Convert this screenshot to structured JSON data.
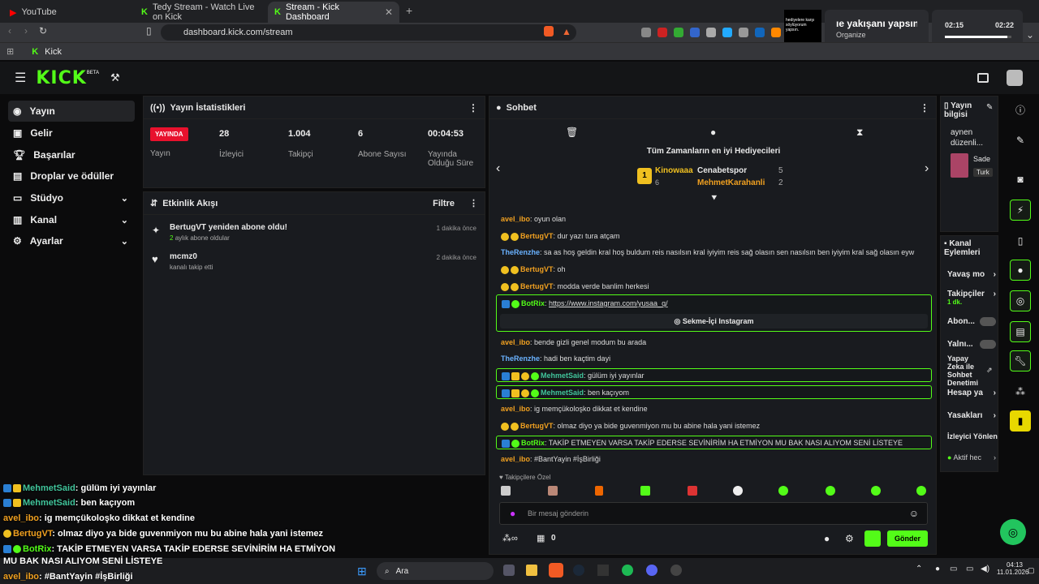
{
  "browser": {
    "tabs": [
      {
        "label": "YouTube"
      },
      {
        "label": "Tedy Stream - Watch Live on Kick"
      },
      {
        "label": "Stream - Kick Dashboard"
      }
    ],
    "url": "dashboard.kick.com/stream",
    "bookmark": "Kick"
  },
  "media": {
    "title": "ıe yakışanı yapsın",
    "subtitle": "Organize",
    "time_start": "02:15",
    "time_end": "02:22",
    "thumb_text": "hediyelere karşı söylüyorum yapsın."
  },
  "header": {
    "logo": "KICK",
    "beta": "BETA"
  },
  "sidebar": {
    "items": [
      {
        "label": "Yayın"
      },
      {
        "label": "Gelir"
      },
      {
        "label": "Başarılar"
      },
      {
        "label": "Droplar ve ödüller"
      },
      {
        "label": "Stüdyo"
      },
      {
        "label": "Kanal"
      },
      {
        "label": "Ayarlar"
      }
    ]
  },
  "stats": {
    "title": "Yayın İstatistikleri",
    "live": "YAYINDA",
    "live_sub": "Yayın",
    "items": [
      {
        "value": "28",
        "label": "İzleyici"
      },
      {
        "value": "1.004",
        "label": "Takipçi"
      },
      {
        "value": "6",
        "label": "Abone Sayısı"
      },
      {
        "value": "00:04:53",
        "label": "Yayında Olduğu Süre"
      }
    ]
  },
  "activity": {
    "title": "Etkinlik Akışı",
    "filter": "Filtre",
    "events": [
      {
        "title": "BertugVT yeniden abone oldu!",
        "sub_a": "2",
        "sub_b": "aylık abone oldular",
        "time": "1 dakika önce"
      },
      {
        "title": "mcmz0",
        "sub": "kanalı takip etti",
        "time": "2 dakika önce"
      }
    ]
  },
  "chat": {
    "title": "Sohbet",
    "gifters_title": "Tüm Zamanların en iyi Hediyecileri",
    "gifters": [
      {
        "name": "Kinowaaa",
        "count": "6"
      },
      {
        "name": "Cenabetspor",
        "count": "5"
      },
      {
        "name": "MehmetKarahanli",
        "count": "2"
      }
    ],
    "lines": [
      {
        "user": "avel_ibo",
        "text": ": oyun olan"
      },
      {
        "user": "BertugVT",
        "text": ": dur yazı tura atçam"
      },
      {
        "user": "TheRenzhe",
        "text": ": sa as hoş geldin kral hoş buldum reis nasılsın kral iyiyim reis sağ olasın sen nasılsın ben iyiyim kral sağ olasın eyw"
      },
      {
        "user": "BertugVT",
        "text": ": oh"
      },
      {
        "user": "BertugVT",
        "text": ": modda verde banlim herkesi"
      },
      {
        "user": "BotRix",
        "text": ": ",
        "link": "https://www.instagram.com/yusaa_q/",
        "button": "Sekme-İçi Instagram"
      },
      {
        "user": "avel_ibo",
        "text": ": bende gizli genel modum bu arada"
      },
      {
        "user": "TheRenzhe",
        "text": ": hadi ben kaçtim dayi"
      },
      {
        "user": "MehmetSaid",
        "text": ": gülüm iyi yayınlar"
      },
      {
        "user": "MehmetSaid",
        "text": ": ben kaçıyom"
      },
      {
        "user": "avel_ibo",
        "text": ": ig memçükoloşko dikkat et kendine"
      },
      {
        "user": "BertugVT",
        "text": ": olmaz diyo ya bide guvenmiyon mu bu abine hala yani istemez"
      },
      {
        "user": "BotRix",
        "text": ": TAKİP ETMEYEN VARSA TAKİP EDERSE SEVİNİRİM HA ETMİYON MU BAK NASI ALIYOM SENİ LİSTEYE"
      },
      {
        "user": "avel_ibo",
        "text": ": #BantYayin #İşBirliği"
      }
    ],
    "followers_only": "Takipçilere Özel",
    "placeholder": "Bir mesaj gönderin",
    "count": "0",
    "send": "Gönder"
  },
  "right": {
    "info_title": "Yayın bilgisi",
    "info_text": "aynen düzenli...",
    "card_name": "Sade",
    "card_tag": "Turk",
    "actions_title": "Kanal Eylemleri",
    "actions": [
      {
        "label": "Yavaş mo"
      },
      {
        "label": "Takipçiler",
        "sub": "1 dk."
      },
      {
        "label": "Abon..."
      },
      {
        "label": "Yalnı..."
      },
      {
        "label": "Yapay Zeka ile Sohbet Denetimi"
      },
      {
        "label": "Hesap ya"
      },
      {
        "label": "Yasakları"
      },
      {
        "label": "İzleyici Yönlen"
      },
      {
        "label": "Aktif hec"
      }
    ]
  },
  "overlay": [
    {
      "user": "MehmetSaid",
      "text": ": gülüm iyi yayınlar"
    },
    {
      "user": "MehmetSaid",
      "text": ": ben kaçıyom"
    },
    {
      "user": "avel_ibo",
      "text": ": ig memçükoloşko dikkat et kendine"
    },
    {
      "user": "BertugVT",
      "text": ": olmaz diyo ya bide guvenmiyon mu bu abine hala yani istemez"
    },
    {
      "user": "BotRix",
      "text": ": TAKİP ETMEYEN VARSA TAKİP EDERSE SEVİNİRİM HA ETMİYON"
    },
    {
      "user": "",
      "text": "MU BAK NASI ALIYOM SENİ LİSTEYE"
    },
    {
      "user": "avel_ibo",
      "text": ": #BantYayin #İşBirliği"
    }
  ],
  "taskbar": {
    "search": "Ara",
    "time": "04:13",
    "date": "11.01.2026"
  },
  "colors": {
    "accent": "#53fc18",
    "live": "#e8112d"
  }
}
